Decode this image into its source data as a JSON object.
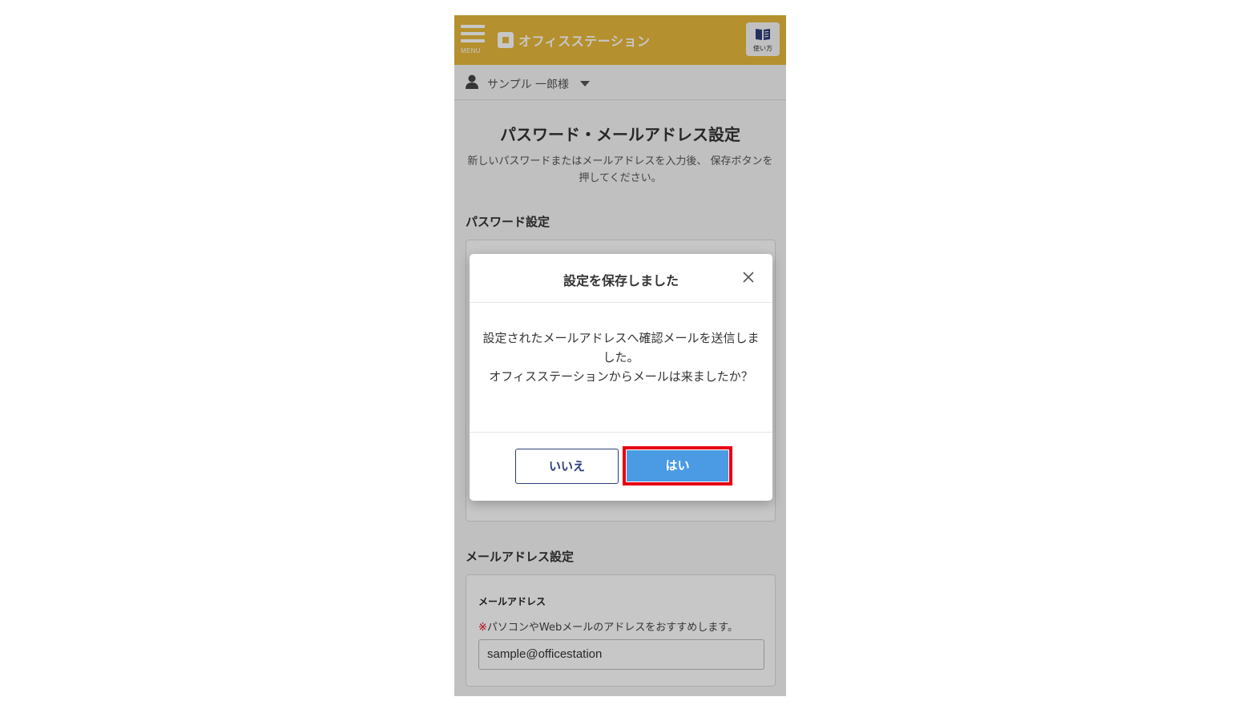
{
  "header": {
    "menu_label": "MENU",
    "logo_text": "オフィスステーション",
    "help_label": "使い方"
  },
  "user": {
    "name": "サンプル 一郎様"
  },
  "page": {
    "title": "パスワード・メールアドレス設定",
    "description": "新しいパスワードまたはメールアドレスを入力後、 保存ボタンを押してください。"
  },
  "password_section": {
    "title": "パスワード設定"
  },
  "email_section": {
    "title": "メールアドレス設定",
    "field_label": "メールアドレス",
    "note_mark": "※",
    "note_text": "パソコンやWebメールのアドレスをおすすめします。",
    "value": "sample@officestation"
  },
  "modal": {
    "title": "設定を保存しました",
    "message_line1": "設定されたメールアドレスへ確認メールを送信しました。",
    "message_line2": "オフィスステーションからメールは来ましたか？",
    "no_label": "いいえ",
    "yes_label": "はい"
  },
  "colors": {
    "header": "#e8b93b",
    "yes_button": "#4a9be3",
    "highlight": "#e60012",
    "no_button_border": "#2c3e7a"
  }
}
